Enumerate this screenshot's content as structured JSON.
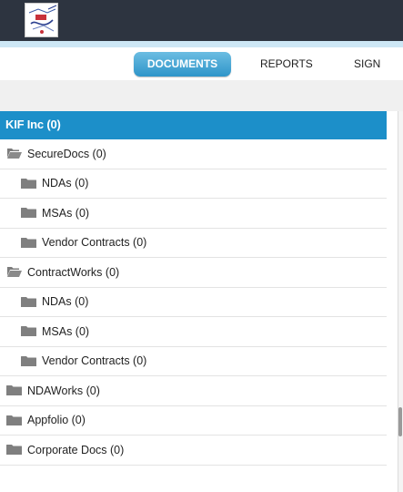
{
  "header": {
    "logo_icon": "company-logo"
  },
  "nav": {
    "documents_label": "DOCUMENTS",
    "reports_label": "REPORTS",
    "sign_label": "SIGN",
    "active_tab": "documents",
    "accent_color": "#1c8fc9"
  },
  "tree": {
    "root_label": "KIF Inc (0)",
    "items": [
      {
        "label": "SecureDocs (0)",
        "icon": "folder-open-icon"
      },
      {
        "label": "NDAs (0)",
        "icon": "folder-icon"
      },
      {
        "label": "MSAs (0)",
        "icon": "folder-icon"
      },
      {
        "label": "Vendor Contracts (0)",
        "icon": "folder-icon"
      },
      {
        "label": "ContractWorks (0)",
        "icon": "folder-open-icon"
      },
      {
        "label": "NDAs (0)",
        "icon": "folder-icon"
      },
      {
        "label": "MSAs (0)",
        "icon": "folder-icon"
      },
      {
        "label": "Vendor Contracts (0)",
        "icon": "folder-icon"
      },
      {
        "label": "NDAWorks (0)",
        "icon": "folder-icon"
      },
      {
        "label": "Appfolio (0)",
        "icon": "folder-icon"
      },
      {
        "label": "Corporate Docs (0)",
        "icon": "folder-icon"
      }
    ]
  }
}
